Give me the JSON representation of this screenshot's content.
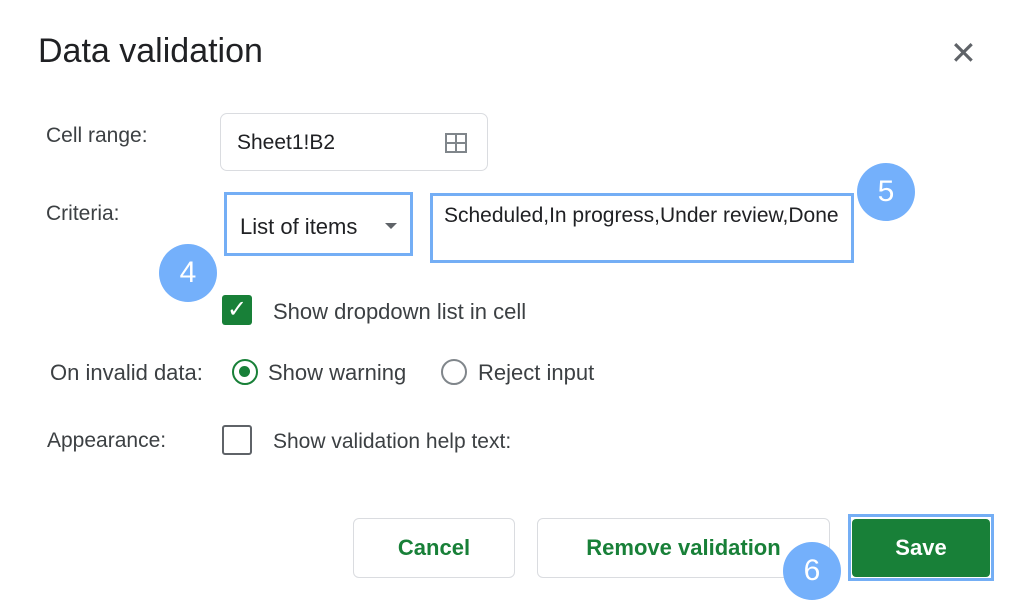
{
  "dialog": {
    "title": "Data validation",
    "close_icon": "close-icon"
  },
  "cell_range": {
    "label": "Cell range:",
    "value": "Sheet1!B2",
    "icon": "grid-select-icon"
  },
  "criteria": {
    "label": "Criteria:",
    "type": "List of items",
    "items_value": "Scheduled,In progress,Under review,Done"
  },
  "show_dropdown": {
    "label": "Show dropdown list in cell",
    "checked": true
  },
  "invalid_data": {
    "label": "On invalid data:",
    "options": [
      {
        "label": "Show warning",
        "selected": true
      },
      {
        "label": "Reject input",
        "selected": false
      }
    ]
  },
  "appearance": {
    "label": "Appearance:",
    "help_text_label": "Show validation help text:",
    "checked": false
  },
  "buttons": {
    "cancel": "Cancel",
    "remove": "Remove validation",
    "save": "Save"
  },
  "step_badges": [
    "4",
    "5",
    "6"
  ],
  "colors": {
    "accent_green": "#188038",
    "highlight_blue": "#74aef5"
  }
}
